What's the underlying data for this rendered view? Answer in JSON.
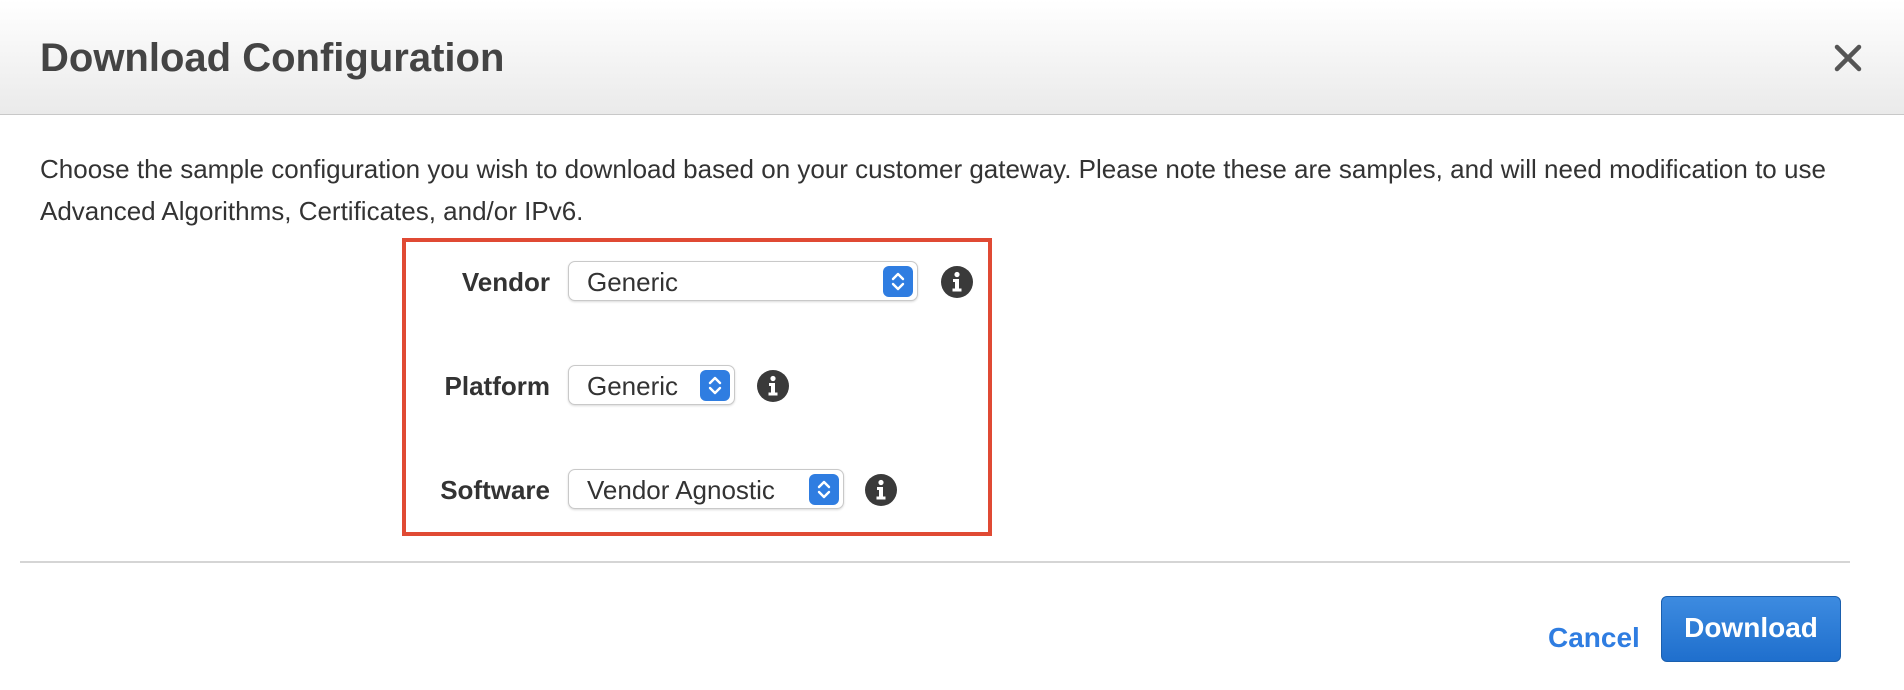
{
  "dialog": {
    "title": "Download Configuration",
    "close_icon": "close-icon",
    "description": "Choose the sample configuration you wish to download based on your customer gateway. Please note these are samples, and will need modification to use Advanced Algorithms, Certificates, and/or IPv6."
  },
  "form": {
    "vendor": {
      "label": "Vendor",
      "value": "Generic",
      "info_icon": "info-icon"
    },
    "platform": {
      "label": "Platform",
      "value": "Generic",
      "info_icon": "info-icon"
    },
    "software": {
      "label": "Software",
      "value": "Vendor Agnostic",
      "info_icon": "info-icon"
    }
  },
  "footer": {
    "cancel_label": "Cancel",
    "download_label": "Download"
  },
  "colors": {
    "accent": "#2f7de1",
    "highlight": "#e04a34",
    "text": "#333333"
  }
}
